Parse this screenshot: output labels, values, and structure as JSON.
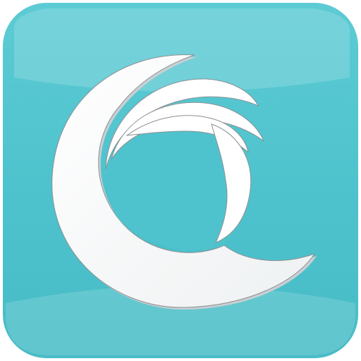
{
  "icon": {
    "name": "wave-icon",
    "colors": {
      "tile_base": "#4fc3cd",
      "tile_light": "#7fd6dd",
      "tile_edge": "#3cb6c1",
      "swirl": "#ffffff",
      "swirl_shadow": "#d9dfe1",
      "outline": "#7a7f82"
    }
  }
}
